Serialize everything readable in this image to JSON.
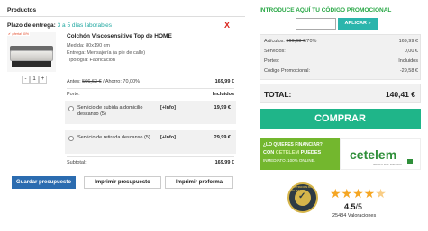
{
  "left": {
    "products_title": "Productos",
    "delivery": {
      "label": "Plazo de entrega:",
      "value": "3 a 5 días laborables"
    },
    "remove_icon": "close-icon",
    "product": {
      "offer_tag": "✔ ¡oferta! 50%",
      "name": "Colchón Viscosensitive Top de HOME",
      "size": "Medida: 80x190 cm",
      "delivery": "Entrega: Mensajería (a pie de calle)",
      "typology": "Tipología: Fabricación",
      "quantity": {
        "minus": "-",
        "value": "1",
        "plus": "+"
      }
    },
    "price": {
      "before_label": "Antes:",
      "before_value": "566,63 €",
      "savings": "/ Ahorro: 70,00%",
      "amount": "169,99 €"
    },
    "porte": {
      "label": "Porte:",
      "value": "Incluidos"
    },
    "services": [
      {
        "label": "Servicio de subida a domicilio descanso (5)",
        "info": "[+Info]",
        "price": "19,99 €"
      },
      {
        "label": "Servicio de retirada descanso (5)",
        "info": "[+Info]",
        "price": "29,99 €"
      }
    ],
    "subtotal": {
      "label": "Subtotal:",
      "value": "169,99 €"
    },
    "buttons": {
      "save": "Guardar presupuesto",
      "print_budget": "Imprimir presupuesto",
      "print_proforma": "Imprimir proforma"
    }
  },
  "right": {
    "promo": {
      "title": "INTRODUCE AQUÍ TU CÓDIGO PROMOCIONAL",
      "placeholder": "",
      "apply": "APLICAR »"
    },
    "summary": {
      "articles_label": "Artículos:",
      "articles_strike": "566,63 €",
      "articles_pct": "/70%",
      "articles_value": "169,99 €",
      "services_label": "Servicios:",
      "services_value": "0,00 €",
      "portes_label": "Portes:",
      "portes_value": "Incluidos",
      "promo_label": "Código Promocional:",
      "promo_value": "-29,58 €"
    },
    "total": {
      "label": "TOTAL:",
      "value": "140,41 €"
    },
    "buy": "COMPRAR",
    "financing": {
      "line1": "¿LO QUIERES FINANCIAR?",
      "line2_a": "CON",
      "line2_b": "CETELEM",
      "line2_c": "PUEDES",
      "line3": "INMEDIATO. 100% ONLINE.",
      "brand": "cetelem",
      "brand_sub": "GRUPO BNP PARIBAS"
    },
    "badge": {
      "ring_text": "DISTINCIÓN DEL CLIENTE",
      "mark": "✓"
    },
    "rating": {
      "stars": "★★★★",
      "half_star": "★",
      "score": "4.5",
      "of": "/5",
      "count": "25484 Valoraciones"
    }
  },
  "colors": {
    "accent_green": "#28a745",
    "buy_green": "#1fb589",
    "teal": "#2bb5ac",
    "blue": "#2b6cb0",
    "red": "#d9251d",
    "star": "#f5a623"
  }
}
